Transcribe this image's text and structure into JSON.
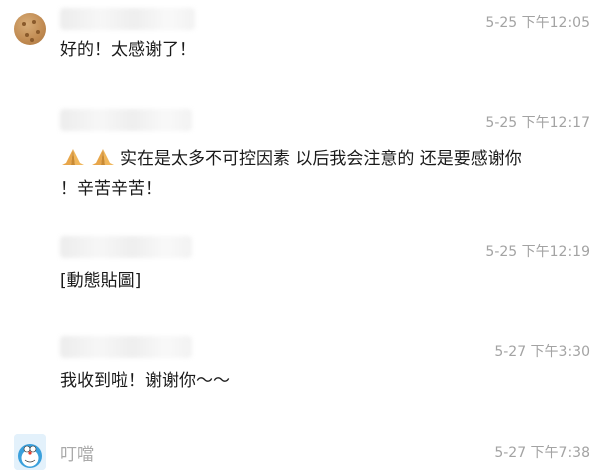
{
  "messages": [
    {
      "time": "5-25 下午12:05",
      "lines": [
        "好的！太感谢了！"
      ]
    },
    {
      "time": "5-25 下午12:17",
      "emoji": [
        "praying-hands-emoji",
        "praying-hands-emoji"
      ],
      "lines": [
        "实在是太多不可控因素 以后我会注意的 还是要感谢你",
        "！辛苦辛苦！"
      ]
    },
    {
      "time": "5-25 下午12:19",
      "lines": [
        "[動態貼圖]"
      ]
    },
    {
      "time": "5-27 下午3:30",
      "lines": [
        "我收到啦！谢谢你～～"
      ]
    },
    {
      "sender": "叮噹",
      "time": "5-27 下午7:38"
    }
  ]
}
